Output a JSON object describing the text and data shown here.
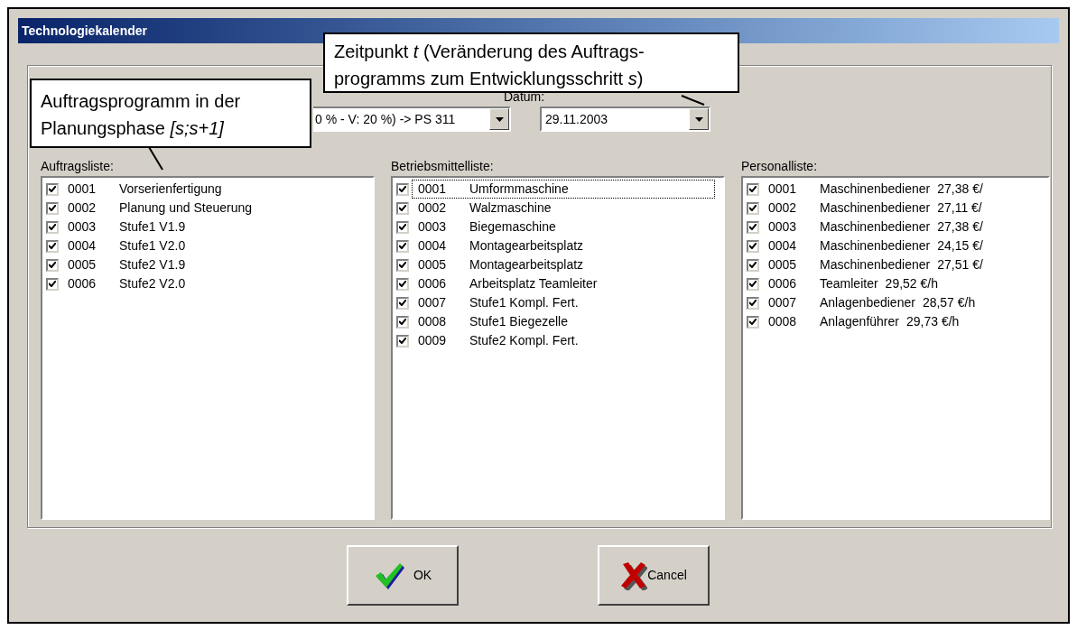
{
  "window": {
    "title": "Technologiekalender"
  },
  "program_select": {
    "value": "0 % - V: 20 %) -> PS 311"
  },
  "date_label": "Datum:",
  "date_select": {
    "value": "29.11.2003"
  },
  "lists": [
    {
      "label": "Auftragsliste:",
      "items": [
        {
          "checked": true,
          "focused": false,
          "code": "0001",
          "name": "Vorserienfertigung"
        },
        {
          "checked": true,
          "focused": false,
          "code": "0002",
          "name": "Planung und Steuerung"
        },
        {
          "checked": true,
          "focused": false,
          "code": "0003",
          "name": "Stufe1 V1.9"
        },
        {
          "checked": true,
          "focused": false,
          "code": "0004",
          "name": "Stufe1 V2.0"
        },
        {
          "checked": true,
          "focused": false,
          "code": "0005",
          "name": "Stufe2 V1.9"
        },
        {
          "checked": true,
          "focused": false,
          "code": "0006",
          "name": "Stufe2 V2.0"
        }
      ]
    },
    {
      "label": "Betriebsmittelliste:",
      "items": [
        {
          "checked": true,
          "focused": true,
          "code": "0001",
          "name": "Umformmaschine"
        },
        {
          "checked": true,
          "focused": false,
          "code": "0002",
          "name": "Walzmaschine"
        },
        {
          "checked": true,
          "focused": false,
          "code": "0003",
          "name": "Biegemaschine"
        },
        {
          "checked": true,
          "focused": false,
          "code": "0004",
          "name": "Montagearbeitsplatz"
        },
        {
          "checked": true,
          "focused": false,
          "code": "0005",
          "name": "Montagearbeitsplatz"
        },
        {
          "checked": true,
          "focused": false,
          "code": "0006",
          "name": "Arbeitsplatz Teamleiter"
        },
        {
          "checked": true,
          "focused": false,
          "code": "0007",
          "name": "Stufe1 Kompl. Fert."
        },
        {
          "checked": true,
          "focused": false,
          "code": "0008",
          "name": "Stufe1 Biegezelle"
        },
        {
          "checked": true,
          "focused": false,
          "code": "0009",
          "name": "Stufe2 Kompl. Fert."
        }
      ]
    },
    {
      "label": "Personalliste:",
      "items": [
        {
          "checked": true,
          "focused": false,
          "code": "0001",
          "name": "Maschinenbediener",
          "rate": "27,38 €/"
        },
        {
          "checked": true,
          "focused": false,
          "code": "0002",
          "name": "Maschinenbediener",
          "rate": "27,11 €/"
        },
        {
          "checked": true,
          "focused": false,
          "code": "0003",
          "name": "Maschinenbediener",
          "rate": "27,38 €/"
        },
        {
          "checked": true,
          "focused": false,
          "code": "0004",
          "name": "Maschinenbediener",
          "rate": "24,15 €/"
        },
        {
          "checked": true,
          "focused": false,
          "code": "0005",
          "name": "Maschinenbediener",
          "rate": "27,51 €/"
        },
        {
          "checked": true,
          "focused": false,
          "code": "0006",
          "name": "Teamleiter",
          "rate": "29,52 €/h"
        },
        {
          "checked": true,
          "focused": false,
          "code": "0007",
          "name": "Anlagenbediener",
          "rate": "28,57 €/h"
        },
        {
          "checked": true,
          "focused": false,
          "code": "0008",
          "name": "Anlagenführer",
          "rate": "29,73 €/h"
        }
      ]
    }
  ],
  "buttons": [
    {
      "kind": "ok",
      "label": "OK"
    },
    {
      "kind": "cancel",
      "label": "Cancel"
    }
  ],
  "callouts": [
    {
      "lines": [
        "Auftragsprogramm in der",
        "Planungsphase *[s;s+1]*"
      ]
    },
    {
      "lines": [
        "Zeitpunkt *t* (Veränderung des Auftrags-",
        "programms zum Entwicklungsschritt *s*)"
      ]
    }
  ]
}
